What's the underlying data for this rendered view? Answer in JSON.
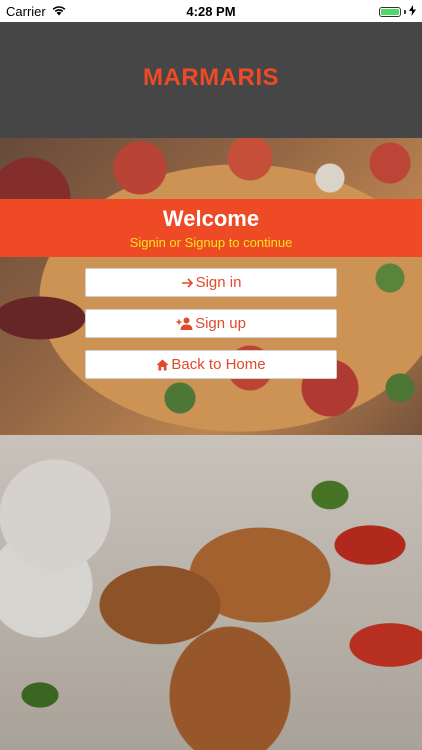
{
  "status_bar": {
    "carrier": "Carrier",
    "time": "4:28 PM",
    "battery_level": 1.0,
    "wifi_icon": "wifi-icon",
    "battery_icon": "battery-icon"
  },
  "header": {
    "brand": "MARMARIS"
  },
  "welcome": {
    "title": "Welcome",
    "subtitle": "Signin or Signup to continue"
  },
  "buttons": {
    "signin": {
      "label": "Sign in",
      "icon": "arrow-right-icon"
    },
    "signup": {
      "label": "Sign up",
      "icon": "add-user-icon"
    },
    "home": {
      "label": "Back to Home",
      "icon": "home-icon"
    }
  },
  "colors": {
    "accent": "#ee4a26",
    "subtitle": "#f7e41b",
    "header_bg": "#464646",
    "button_text": "#e04a2a"
  }
}
